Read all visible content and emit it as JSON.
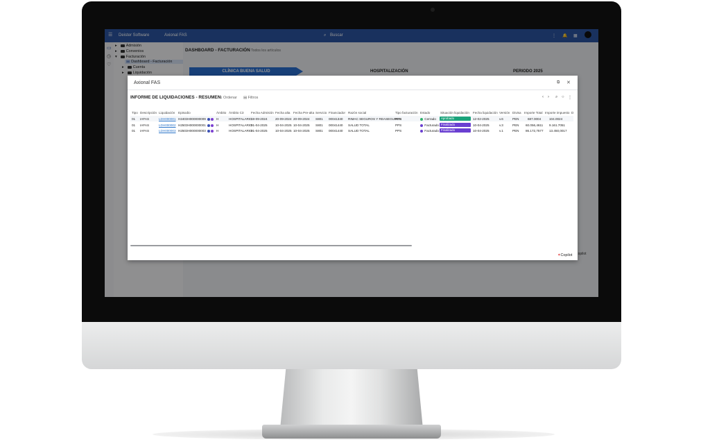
{
  "topbar": {
    "app_name": "Deister Software",
    "company": "Axional FAS",
    "search_placeholder": "Buscar"
  },
  "tree": {
    "items": [
      {
        "label": "Admisión",
        "expanded": false
      },
      {
        "label": "Convenios",
        "expanded": false
      },
      {
        "label": "Facturación",
        "expanded": true
      },
      {
        "label": "Dashboard - Facturación",
        "selected": true
      },
      {
        "label": "Cuenta",
        "expanded": false
      },
      {
        "label": "Liquidación",
        "expanded": false
      }
    ]
  },
  "dashboard": {
    "title": "DASHBOARD - FACTURACIÓN",
    "filter_label": "Todos los artículos",
    "banner_1": "CLÍNICA BUENA SALUD",
    "banner_2": "HOSPITALIZACIÓN",
    "banner_3": "PERIODO 2025",
    "copilot": "Copilot"
  },
  "modal": {
    "title": "Axional FAS",
    "report_title": "INFORME DE LIQUIDACIONES - RESUMEN",
    "sort_label": "Ordenar",
    "filter_label": "Filtros",
    "columns": [
      "Tipo",
      "Descripción",
      "Liquidación",
      "Episodio",
      "Ámbito",
      "Ámbito C3",
      "Fecha Admisión",
      "Fecha alta",
      "Fecha Pre-alta",
      "Servicio",
      "Financiador",
      "Razón social",
      "Tipo facturación",
      "Estado",
      "Situación liquidación",
      "Fecha liquidación",
      "Versión",
      "Divisa",
      "Importe Total",
      "Importe impuesto",
      "D"
    ],
    "rows": [
      {
        "tipo": "01",
        "desc": "IAFAS",
        "liq": "LDH000001",
        "episodio": "H2403H000000009",
        "ambito": "H",
        "ambito_c3": "HOSPITALARIO",
        "f_adm": "19-09-2024",
        "f_alta": "20-09-2024",
        "f_prealta": "20-09-2024",
        "servicio": "S801",
        "financiador": "00041340",
        "razon": "RIMAC SEGUROS Y REASEGUROS",
        "tipo_fact": "PPS",
        "estado": "Cerrado",
        "situacion": "Aprobado",
        "f_liq": "12-02-2025",
        "version": "v.6",
        "divisa": "PEN",
        "importe": "687.0004",
        "impuesto": "104.0024"
      },
      {
        "tipo": "01",
        "desc": "IAFAS",
        "liq": "LDH000002",
        "episodio": "H2503H000000001",
        "ambito": "H",
        "ambito_c3": "HOSPITALARIO",
        "f_adm": "01-04-2025",
        "f_alta": "10-04-2025",
        "f_prealta": "10-04-2025",
        "servicio": "S801",
        "financiador": "00041440",
        "razon": "SALUD TOTAL",
        "tipo_fact": "PPS",
        "estado": "Facturado",
        "situacion": "Finalizado",
        "f_liq": "10-04-2025",
        "version": "v.3",
        "divisa": "PEN",
        "importe": "60.056,4611",
        "impuesto": "9.161.7051"
      },
      {
        "tipo": "01",
        "desc": "IAFAS",
        "liq": "LDH000003",
        "episodio": "H2503H000000003",
        "ambito": "H",
        "ambito_c3": "HOSPITALARIO",
        "f_adm": "01-04-2025",
        "f_alta": "10-04-2025",
        "f_prealta": "10-04-2025",
        "servicio": "S801",
        "financiador": "00041440",
        "razon": "SALUD TOTAL",
        "tipo_fact": "PPS",
        "estado": "Facturado",
        "situacion": "Finalizado",
        "f_liq": "10-04-2025",
        "version": "v.1",
        "divisa": "PEN",
        "importe": "86.172,7577",
        "impuesto": "13.450,0017"
      }
    ],
    "colors": {
      "approved": "#1aa37a",
      "finalized": "#6a3fd1",
      "closed_dot": "#2fb36b",
      "billed_dot": "#6a3fd1",
      "episode_dot_1": "#3a4fb5",
      "episode_dot_2": "#7b3fd1"
    },
    "copilot": "Copilot"
  }
}
